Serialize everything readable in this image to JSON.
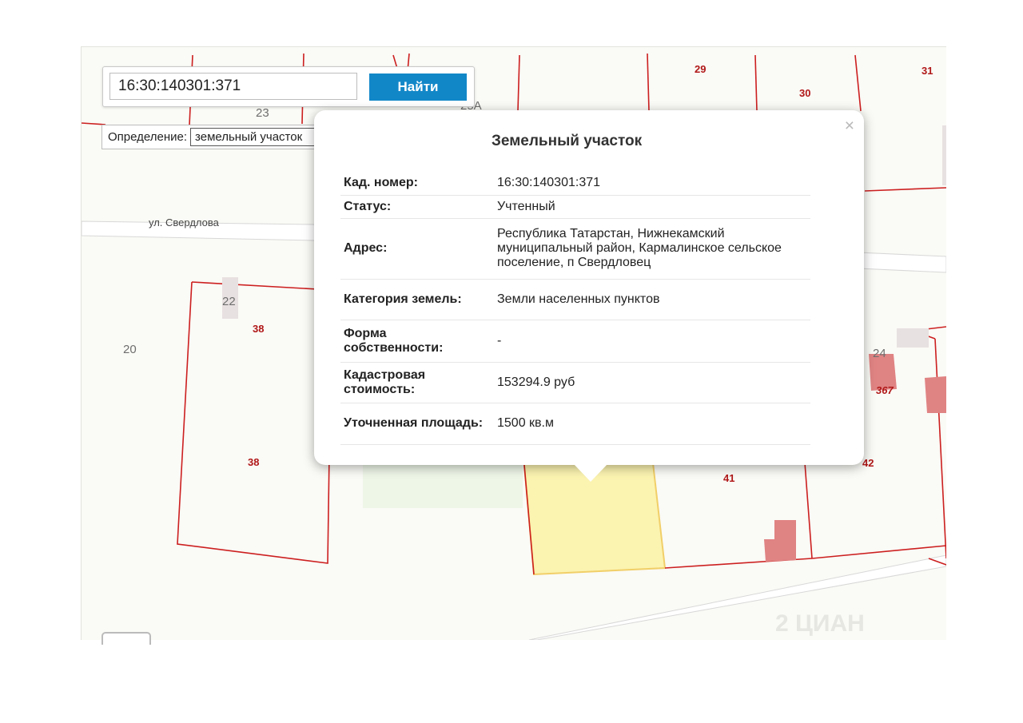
{
  "search": {
    "value": "16:30:140301:371",
    "button_label": "Найти"
  },
  "definition": {
    "label": "Определение:",
    "selected": "земельный участок"
  },
  "map": {
    "street": "ул. Свердлова",
    "parcel_labels": [
      "29",
      "30",
      "31",
      "38",
      "38",
      "41",
      "42",
      "367",
      "23",
      "24",
      "25А"
    ],
    "house_numbers": [
      "20",
      "22",
      "23",
      "25А"
    ],
    "watermark": "2 ЦИАН"
  },
  "popup": {
    "title": "Земельный участок",
    "close": "×",
    "rows": [
      {
        "key": "Кад. номер:",
        "value": "16:30:140301:371"
      },
      {
        "key": "Статус:",
        "value": "Учтенный"
      },
      {
        "key": "Адрес:",
        "value": "Республика Татарстан, Нижнекамский муниципальный район, Кармалинское сельское поселение, п Свердловец"
      },
      {
        "key": "Категория земель:",
        "value": "Земли населенных пунктов"
      },
      {
        "key": "Форма собственности:",
        "value": "-"
      },
      {
        "key": "Кадастровая стоимость:",
        "value": "153294.9 руб"
      },
      {
        "key": "Уточненная площадь:",
        "value": "1500 кв.м"
      }
    ]
  },
  "colors": {
    "parcel_border": "#cc1f1f",
    "selected_parcel": "#fbf3b0",
    "button": "#1287c8",
    "building": "#e08383"
  }
}
